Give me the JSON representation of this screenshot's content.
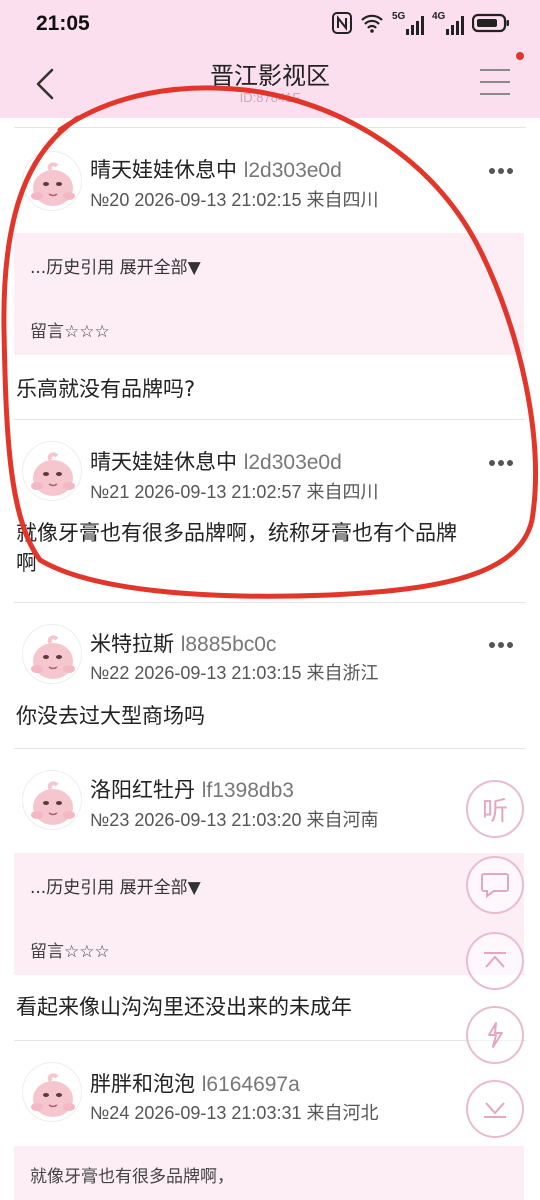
{
  "status_bar": {
    "time": "21:05",
    "network_a": "5G",
    "network_b": "4G"
  },
  "header": {
    "title": "晋江影视区",
    "subtitle": "ID:87841F"
  },
  "posts": [
    {
      "username": "晴天娃娃休息中",
      "user_id": "l2d303e0d",
      "meta": "№20 2026-09-13 21:02:15 来自四川",
      "quote": {
        "history": "...历史引用 展开全部▼",
        "message": "留言☆☆☆"
      },
      "body": "乐高就没有品牌吗?"
    },
    {
      "username": "晴天娃娃休息中",
      "user_id": "l2d303e0d",
      "meta": "№21 2026-09-13 21:02:57 来自四川",
      "body_line1": "就像牙膏也有很多品牌啊，统称牙膏也有个品牌",
      "body_line2": "啊"
    },
    {
      "username": "米特拉斯",
      "user_id": "l8885bc0c",
      "meta": "№22 2026-09-13 21:03:15 来自浙江",
      "body": "你没去过大型商场吗"
    },
    {
      "username": "洛阳红牡丹",
      "user_id": "lf1398db3",
      "meta": "№23 2026-09-13 21:03:20 来自河南",
      "quote": {
        "history": "...历史引用 展开全部▼",
        "message": "留言☆☆☆"
      },
      "body": "看起来像山沟沟里还没出来的未成年"
    },
    {
      "username": "胖胖和泡泡",
      "user_id": "l6164697a",
      "meta": "№24 2026-09-13 21:03:31 来自河北",
      "quote": {
        "line1": "就像牙膏也有很多品牌啊，"
      }
    }
  ],
  "fab": {
    "listen": "听"
  },
  "colors": {
    "header_bg": "#fbdfee",
    "quote_bg": "#fdeef6",
    "annotation": "#e3362b",
    "fab_border": "#e8bcd0"
  }
}
